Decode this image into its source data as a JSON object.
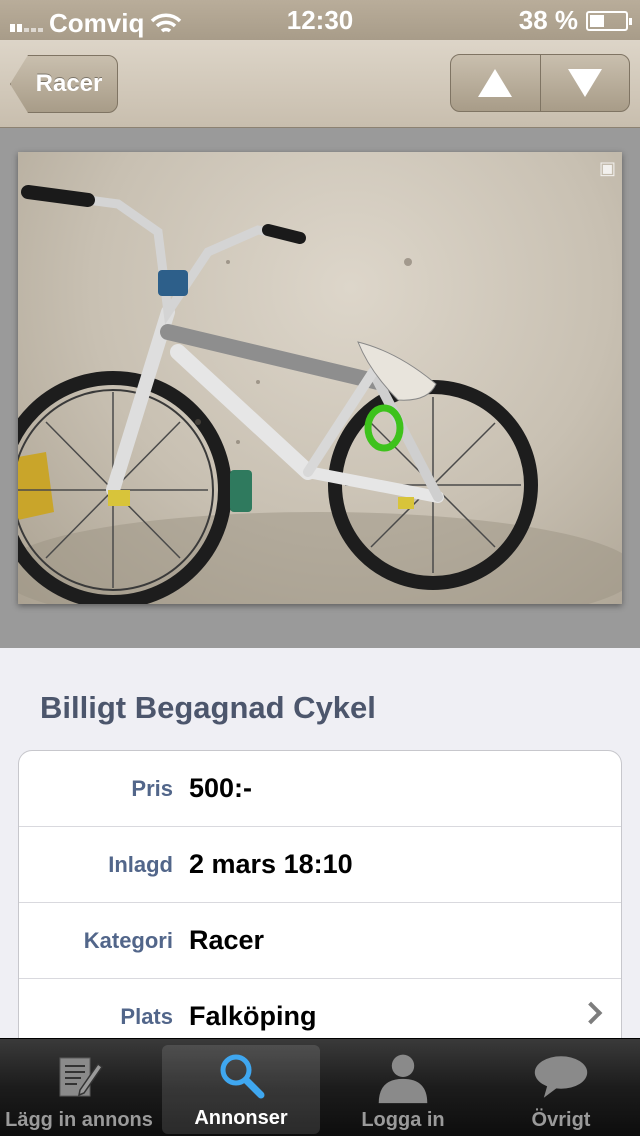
{
  "status_bar": {
    "carrier": "Comviq",
    "time": "12:30",
    "battery": "38 %"
  },
  "nav": {
    "back_label": "Racer"
  },
  "listing": {
    "title": "Billigt Begagnad Cykel",
    "rows": [
      {
        "label": "Pris",
        "value": "500:-"
      },
      {
        "label": "Inlagd",
        "value": "2 mars 18:10"
      },
      {
        "label": "Kategori",
        "value": "Racer"
      },
      {
        "label": "Plats",
        "value": "Falköping"
      }
    ]
  },
  "tabs": [
    {
      "label": "Lägg in annons",
      "icon": "compose-icon"
    },
    {
      "label": "Annonser",
      "icon": "search-icon",
      "active": true
    },
    {
      "label": "Logga in",
      "icon": "user-icon"
    },
    {
      "label": "Övrigt",
      "icon": "chat-bubble-icon"
    }
  ],
  "colors": {
    "label": "#52668a",
    "title": "#4c566c",
    "active_icon": "#3fa7f0"
  }
}
